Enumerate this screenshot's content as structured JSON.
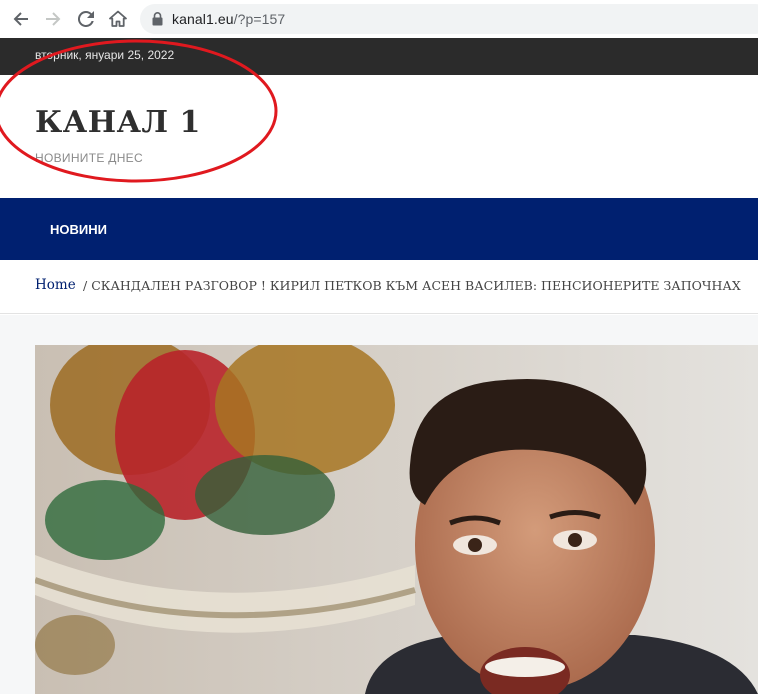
{
  "browser": {
    "url_host": "kanal1.eu",
    "url_path": "/?p=157"
  },
  "topbar": {
    "date": "вторник, януари 25, 2022"
  },
  "header": {
    "title": "КАНАЛ 1",
    "tagline": "НОВИНИТЕ ДНЕС"
  },
  "navigation": {
    "items": [
      {
        "label": "НОВИНИ"
      }
    ]
  },
  "breadcrumb": {
    "home": "Home",
    "separator": "/",
    "current": "СКАНДАЛЕН РАЗГОВОР ! КИРИЛ ПЕТКОВ КЪМ АСЕН ВАСИЛЕВ: ПЕНСИОНЕРИТЕ ЗАПОЧНАХ"
  },
  "colors": {
    "nav_background": "#002070",
    "topbar_background": "#2b2b2b",
    "annotation": "#e0191f"
  },
  "icons": [
    "back-arrow-icon",
    "forward-arrow-icon",
    "reload-icon",
    "home-icon",
    "lock-icon"
  ]
}
